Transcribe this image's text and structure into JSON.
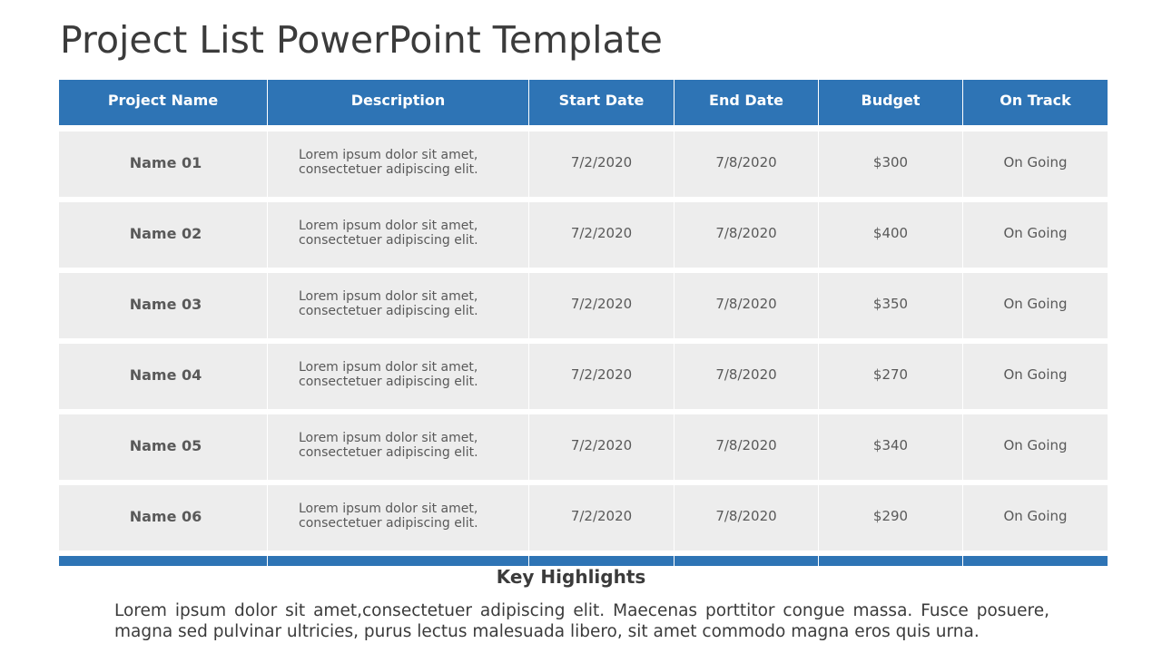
{
  "slide": {
    "title": "Project List PowerPoint Template",
    "accent_color": "#2E74B5",
    "row_color": "#EDEDED"
  },
  "table": {
    "headers": [
      "Project Name",
      "Description",
      "Start Date",
      "End Date",
      "Budget",
      "On Track"
    ],
    "rows": [
      {
        "name": "Name 01",
        "desc_line1": "Lorem ipsum dolor sit amet,",
        "desc_line2": "consectetuer adipiscing elit.",
        "start": "7/2/2020",
        "end": "7/8/2020",
        "budget": "$300",
        "status": "On Going"
      },
      {
        "name": "Name 02",
        "desc_line1": "Lorem ipsum dolor sit amet,",
        "desc_line2": "consectetuer adipiscing elit.",
        "start": "7/2/2020",
        "end": "7/8/2020",
        "budget": "$400",
        "status": "On Going"
      },
      {
        "name": "Name 03",
        "desc_line1": "Lorem ipsum dolor sit amet,",
        "desc_line2": "consectetuer adipiscing elit.",
        "start": "7/2/2020",
        "end": "7/8/2020",
        "budget": "$350",
        "status": "On Going"
      },
      {
        "name": "Name 04",
        "desc_line1": "Lorem ipsum dolor sit amet,",
        "desc_line2": "consectetuer adipiscing elit.",
        "start": "7/2/2020",
        "end": "7/8/2020",
        "budget": "$270",
        "status": "On Going"
      },
      {
        "name": "Name 05",
        "desc_line1": "Lorem ipsum dolor sit amet,",
        "desc_line2": "consectetuer adipiscing elit.",
        "start": "7/2/2020",
        "end": "7/8/2020",
        "budget": "$340",
        "status": "On Going"
      },
      {
        "name": "Name 06",
        "desc_line1": "Lorem ipsum dolor sit amet,",
        "desc_line2": "consectetuer adipiscing elit.",
        "start": "7/2/2020",
        "end": "7/8/2020",
        "budget": "$290",
        "status": "On Going"
      }
    ]
  },
  "highlights": {
    "title": "Key Highlights",
    "body": "Lorem ipsum dolor sit amet,consectetuer adipiscing elit. Maecenas porttitor congue massa. Fusce posuere, magna sed pulvinar ultricies, purus lectus malesuada libero, sit amet commodo magna eros quis urna."
  }
}
